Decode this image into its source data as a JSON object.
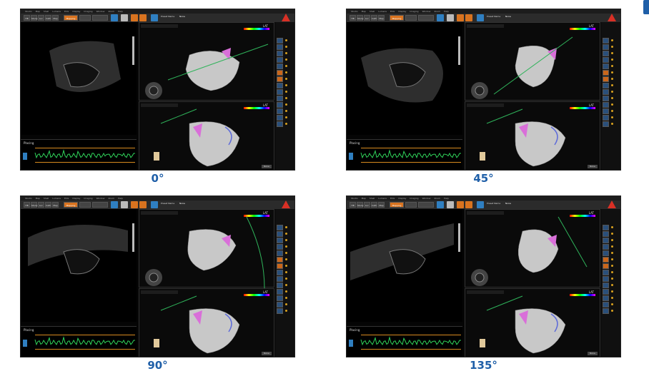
{
  "app": {
    "menu": [
      "Studio",
      "Map",
      "Shell",
      "Lumens",
      "ECG",
      "Display",
      "Imaging",
      "Window",
      "Zoom",
      "Help"
    ],
    "tabs": [
      "HB",
      "Study",
      "Loc",
      "Cath",
      "Map"
    ],
    "mode_tab": "Mapping",
    "preset_label": "Preset Name",
    "preset_value": "None",
    "view_label_top": "LAT",
    "view_label_bottom": "LAT",
    "ecg_label": "Placing",
    "none_button": "None",
    "accent_orange": "#d9731f",
    "accent_blue": "#2f7fc1",
    "mesh_color": "#c8c8c8",
    "catheter_color": "#d96fd9"
  },
  "panels": [
    {
      "caption": "0°"
    },
    {
      "caption": "45°"
    },
    {
      "caption": "90°"
    },
    {
      "caption": "135°"
    }
  ]
}
